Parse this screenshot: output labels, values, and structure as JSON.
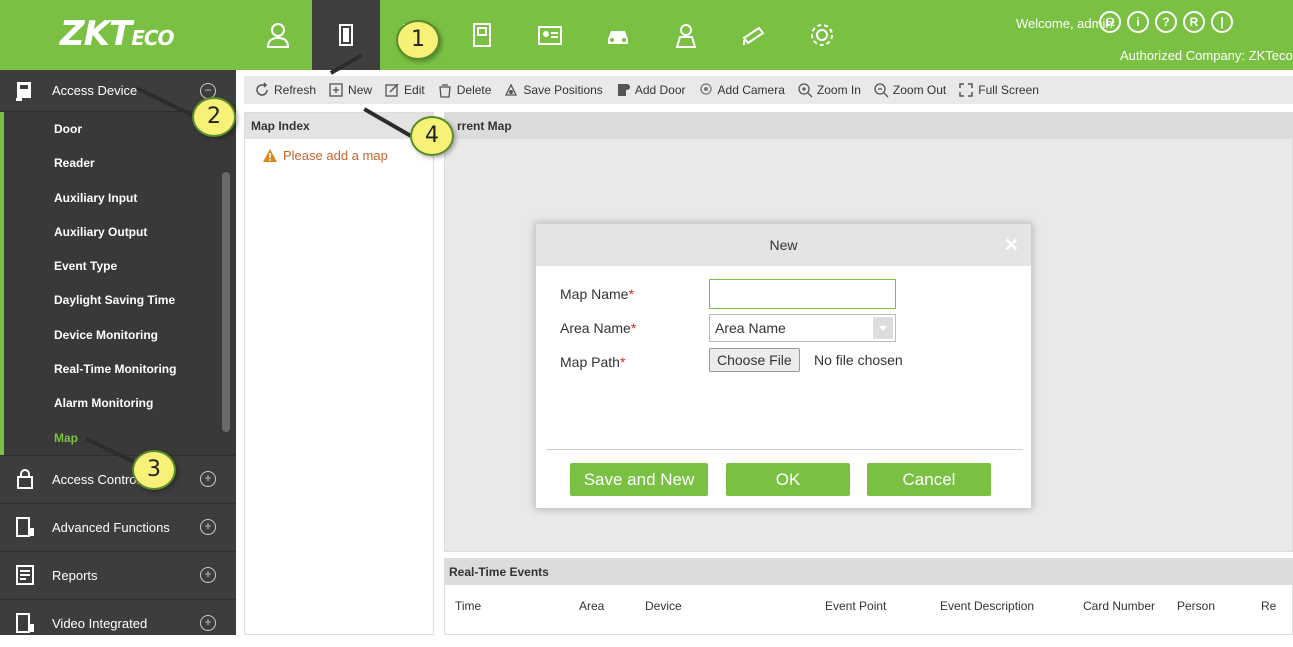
{
  "brand": {
    "logo_main": "ZKT",
    "logo_sub": "ECO"
  },
  "topbar": {
    "welcome": "Welcome, admin",
    "authorized": "Authorized Company: ZKTeco",
    "nav_icons": [
      "personnel-icon",
      "access-icon",
      "elevator-icon",
      "attendance-icon",
      "visitor-icon",
      "parking-icon",
      "patrol-icon",
      "video-icon",
      "system-icon"
    ]
  },
  "sidebar": {
    "section": "Access Device",
    "items": [
      "Door",
      "Reader",
      "Auxiliary Input",
      "Auxiliary Output",
      "Event Type",
      "Daylight Saving Time",
      "Device Monitoring",
      "Real-Time Monitoring",
      "Alarm Monitoring",
      "Map"
    ],
    "groups": [
      "Access Control",
      "Advanced Functions",
      "Reports",
      "Video Integrated"
    ]
  },
  "toolbar": {
    "refresh": "Refresh",
    "new": "New",
    "edit": "Edit",
    "delete": "Delete",
    "save_positions": "Save Positions",
    "add_door": "Add Door",
    "add_camera": "Add Camera",
    "zoom_in": "Zoom In",
    "zoom_out": "Zoom Out",
    "full_screen": "Full Screen"
  },
  "map_index": {
    "title": "Map Index",
    "warning": "Please add a map"
  },
  "current_map": {
    "title": "rrent Map"
  },
  "events": {
    "title": "Real-Time Events",
    "columns": [
      "Time",
      "Area",
      "Device",
      "Event Point",
      "Event Description",
      "Card Number",
      "Person",
      "Re"
    ]
  },
  "dialog": {
    "title": "New",
    "map_name_label": "Map Name",
    "area_name_label": "Area Name",
    "map_path_label": "Map Path",
    "area_name_value": "Area Name",
    "choose_file": "Choose File",
    "no_file": "No file chosen",
    "save_and_new": "Save and New",
    "ok": "OK",
    "cancel": "Cancel"
  },
  "annotations": [
    "1",
    "2",
    "3",
    "4"
  ],
  "colors": {
    "accent": "#7ac143",
    "sidebar": "#3d3d3d",
    "bubble": "#f7f178"
  }
}
